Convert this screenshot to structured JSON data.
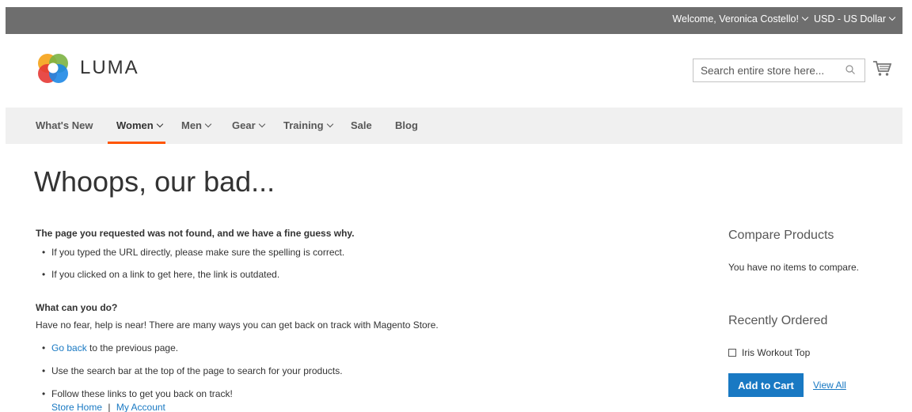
{
  "header": {
    "welcome": "Welcome, Veronica Costello!",
    "currency": "USD - US Dollar",
    "logo_text": "LUMA",
    "search_placeholder": "Search entire store here..."
  },
  "nav": {
    "items": [
      "What's New",
      "Women",
      "Men",
      "Gear",
      "Training",
      "Sale",
      "Blog"
    ]
  },
  "page": {
    "title": "Whoops, our bad...",
    "intro": "The page you requested was not found, and we have a fine guess why.",
    "reasons": [
      "If you typed the URL directly, please make sure the spelling is correct.",
      "If you clicked on a link to get here, the link is outdated."
    ],
    "what_heading": "What can you do?",
    "what_text": "Have no fear, help is near! There are many ways you can get back on track with Magento Store.",
    "go_back_link": "Go back",
    "go_back_rest": " to the previous page.",
    "search_tip": "Use the search bar at the top of the page to search for your products.",
    "follow_links": "Follow these links to get you back on track!",
    "store_home": "Store Home",
    "separator": "|",
    "my_account": "My Account"
  },
  "sidebar": {
    "compare_title": "Compare Products",
    "compare_text": "You have no items to compare.",
    "recent_title": "Recently Ordered",
    "recent_item": "Iris Workout Top",
    "add_to_cart": "Add to Cart",
    "view_all": "View All"
  },
  "colors": {
    "accent": "#1979c3",
    "nav_active": "#ff5501",
    "topbar": "#6e6e6e"
  }
}
